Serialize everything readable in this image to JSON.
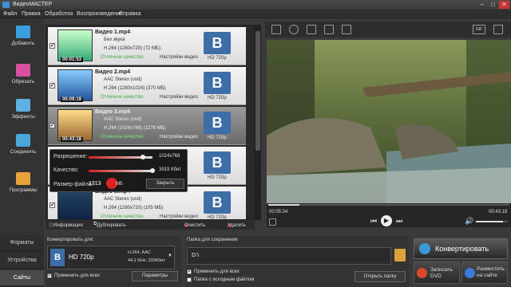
{
  "window": {
    "title": "ВидеоМАСТЕР",
    "controls": [
      "–",
      "□",
      "✕"
    ]
  },
  "menu": [
    "Файл",
    "Правка",
    "Обработка",
    "Воспроизведение",
    "Справка"
  ],
  "left_buttons": [
    {
      "label": "Добавить",
      "icon": "add-icon",
      "color": "#3aa0dd"
    },
    {
      "label": "Обрезать",
      "icon": "cut-icon",
      "color": "#d84f9f"
    },
    {
      "label": "Эффекты",
      "icon": "effects-icon",
      "color": "#5db0e0"
    },
    {
      "label": "Соединить",
      "icon": "join-icon",
      "color": "#4aa8d8"
    },
    {
      "label": "Программы",
      "icon": "programs-icon",
      "color": "#e8a33a"
    }
  ],
  "videos": [
    {
      "name": "Видео 1.mp4",
      "audio": "Без звука",
      "codec": "H.264 (1280x720) (72 МБ)",
      "quality": "Отличное качество",
      "settings": "Настройки видео",
      "duration": "00:01:53",
      "format": "HD 720p",
      "checked": true
    },
    {
      "name": "Видео 2.mp4",
      "audio": "AAC Stereo (und)",
      "codec": "H.264 (1280x1024) (370 МБ)",
      "quality": "Отличное качество",
      "settings": "Настройки видео",
      "duration": "00:09:19",
      "format": "HD 720p",
      "checked": true
    },
    {
      "name": "Видео 3.mp4",
      "audio": "AAC Stereo (und)",
      "codec": "H.264 (1024x768) (1276 МБ)",
      "quality": "Отличное качество",
      "settings": "Настройки видео",
      "duration": "00:43:18",
      "format": "HD 720p",
      "checked": true
    },
    {
      "name": "",
      "audio": "",
      "codec": "",
      "quality": "",
      "settings": "",
      "duration": "",
      "format": "HD 720p",
      "checked": true
    },
    {
      "name": "Видео 5.mp4",
      "audio": "AAC Stereo (und)",
      "codec": "H.264 (1280x720) (105 МБ)",
      "quality": "Отличное качество",
      "settings": "Настройки видео",
      "duration": "",
      "format": "HD 720p",
      "checked": true
    }
  ],
  "popup": {
    "resolution_label": "Разрешение:",
    "resolution_value": "1024x768",
    "quality_label": "Качество:",
    "quality_value": "3919 Кбит",
    "filesize_label": "Размер файла:",
    "filesize_value": "1313",
    "filesize_unit": "МБ",
    "close_label": "Закрыть"
  },
  "listbar": {
    "info": "Информация",
    "duplicate": "Дублировать",
    "clear": "Очистить",
    "delete": "Удалить"
  },
  "player": {
    "time_current": "00:05:34",
    "time_total": "00:43:18",
    "gif_label": "GIF",
    "progress": 0.13,
    "volume": 0.85
  },
  "tabs": [
    "Форматы",
    "Устройства",
    "Сайты"
  ],
  "convert_for": {
    "label": "Конвертировать для:",
    "format": "HD 720p",
    "specs1": "H.264, AAC",
    "specs2": "44,1 KHz, 320Кбит",
    "apply_all": "Применить для всех",
    "params": "Параметры"
  },
  "save_to": {
    "label": "Папка для сохранения:",
    "path": "D:\\",
    "apply_all": "Применить для всех",
    "source_folder": "Папка с исходным файлом",
    "open_folder": "Открыть папку"
  },
  "actions": {
    "convert": "Конвертировать",
    "burn_dvd": "Записать DVD",
    "publish": "Разместить на сайте"
  }
}
